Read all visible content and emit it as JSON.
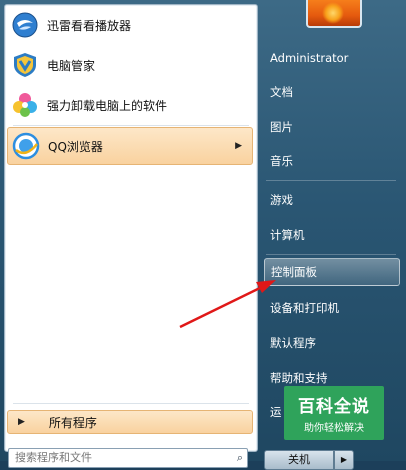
{
  "left_pane": {
    "programs": [
      {
        "label": "迅雷看看播放器",
        "icon": "xunlei-player-icon"
      },
      {
        "label": "电脑管家",
        "icon": "pc-manager-shield-icon"
      },
      {
        "label": "强力卸载电脑上的软件",
        "icon": "uninstaller-petals-icon"
      },
      {
        "label": "QQ浏览器",
        "icon": "qq-browser-icon",
        "submenu_arrow": "▶"
      }
    ],
    "all_programs": {
      "arrow": "▶",
      "label": "所有程序"
    },
    "search": {
      "placeholder": "搜索程序和文件",
      "icon": "search-icon"
    }
  },
  "right_pane": {
    "items": [
      {
        "label": "Administrator"
      },
      {
        "label": "文档"
      },
      {
        "label": "图片"
      },
      {
        "label": "音乐"
      },
      {
        "label": "游戏"
      },
      {
        "label": "计算机"
      },
      {
        "label": "控制面板"
      },
      {
        "label": "设备和打印机"
      },
      {
        "label": "默认程序"
      },
      {
        "label": "帮助和支持"
      },
      {
        "label": "运"
      }
    ],
    "shutdown_label": "关机",
    "shutdown_arrow": "▶"
  },
  "watermark": {
    "title": "百科全说",
    "subtitle": "助你轻松解决"
  },
  "colors": {
    "annotation_arrow": "#e01818",
    "highlight": "#f9d29f",
    "watermark": "#2fa35b"
  }
}
